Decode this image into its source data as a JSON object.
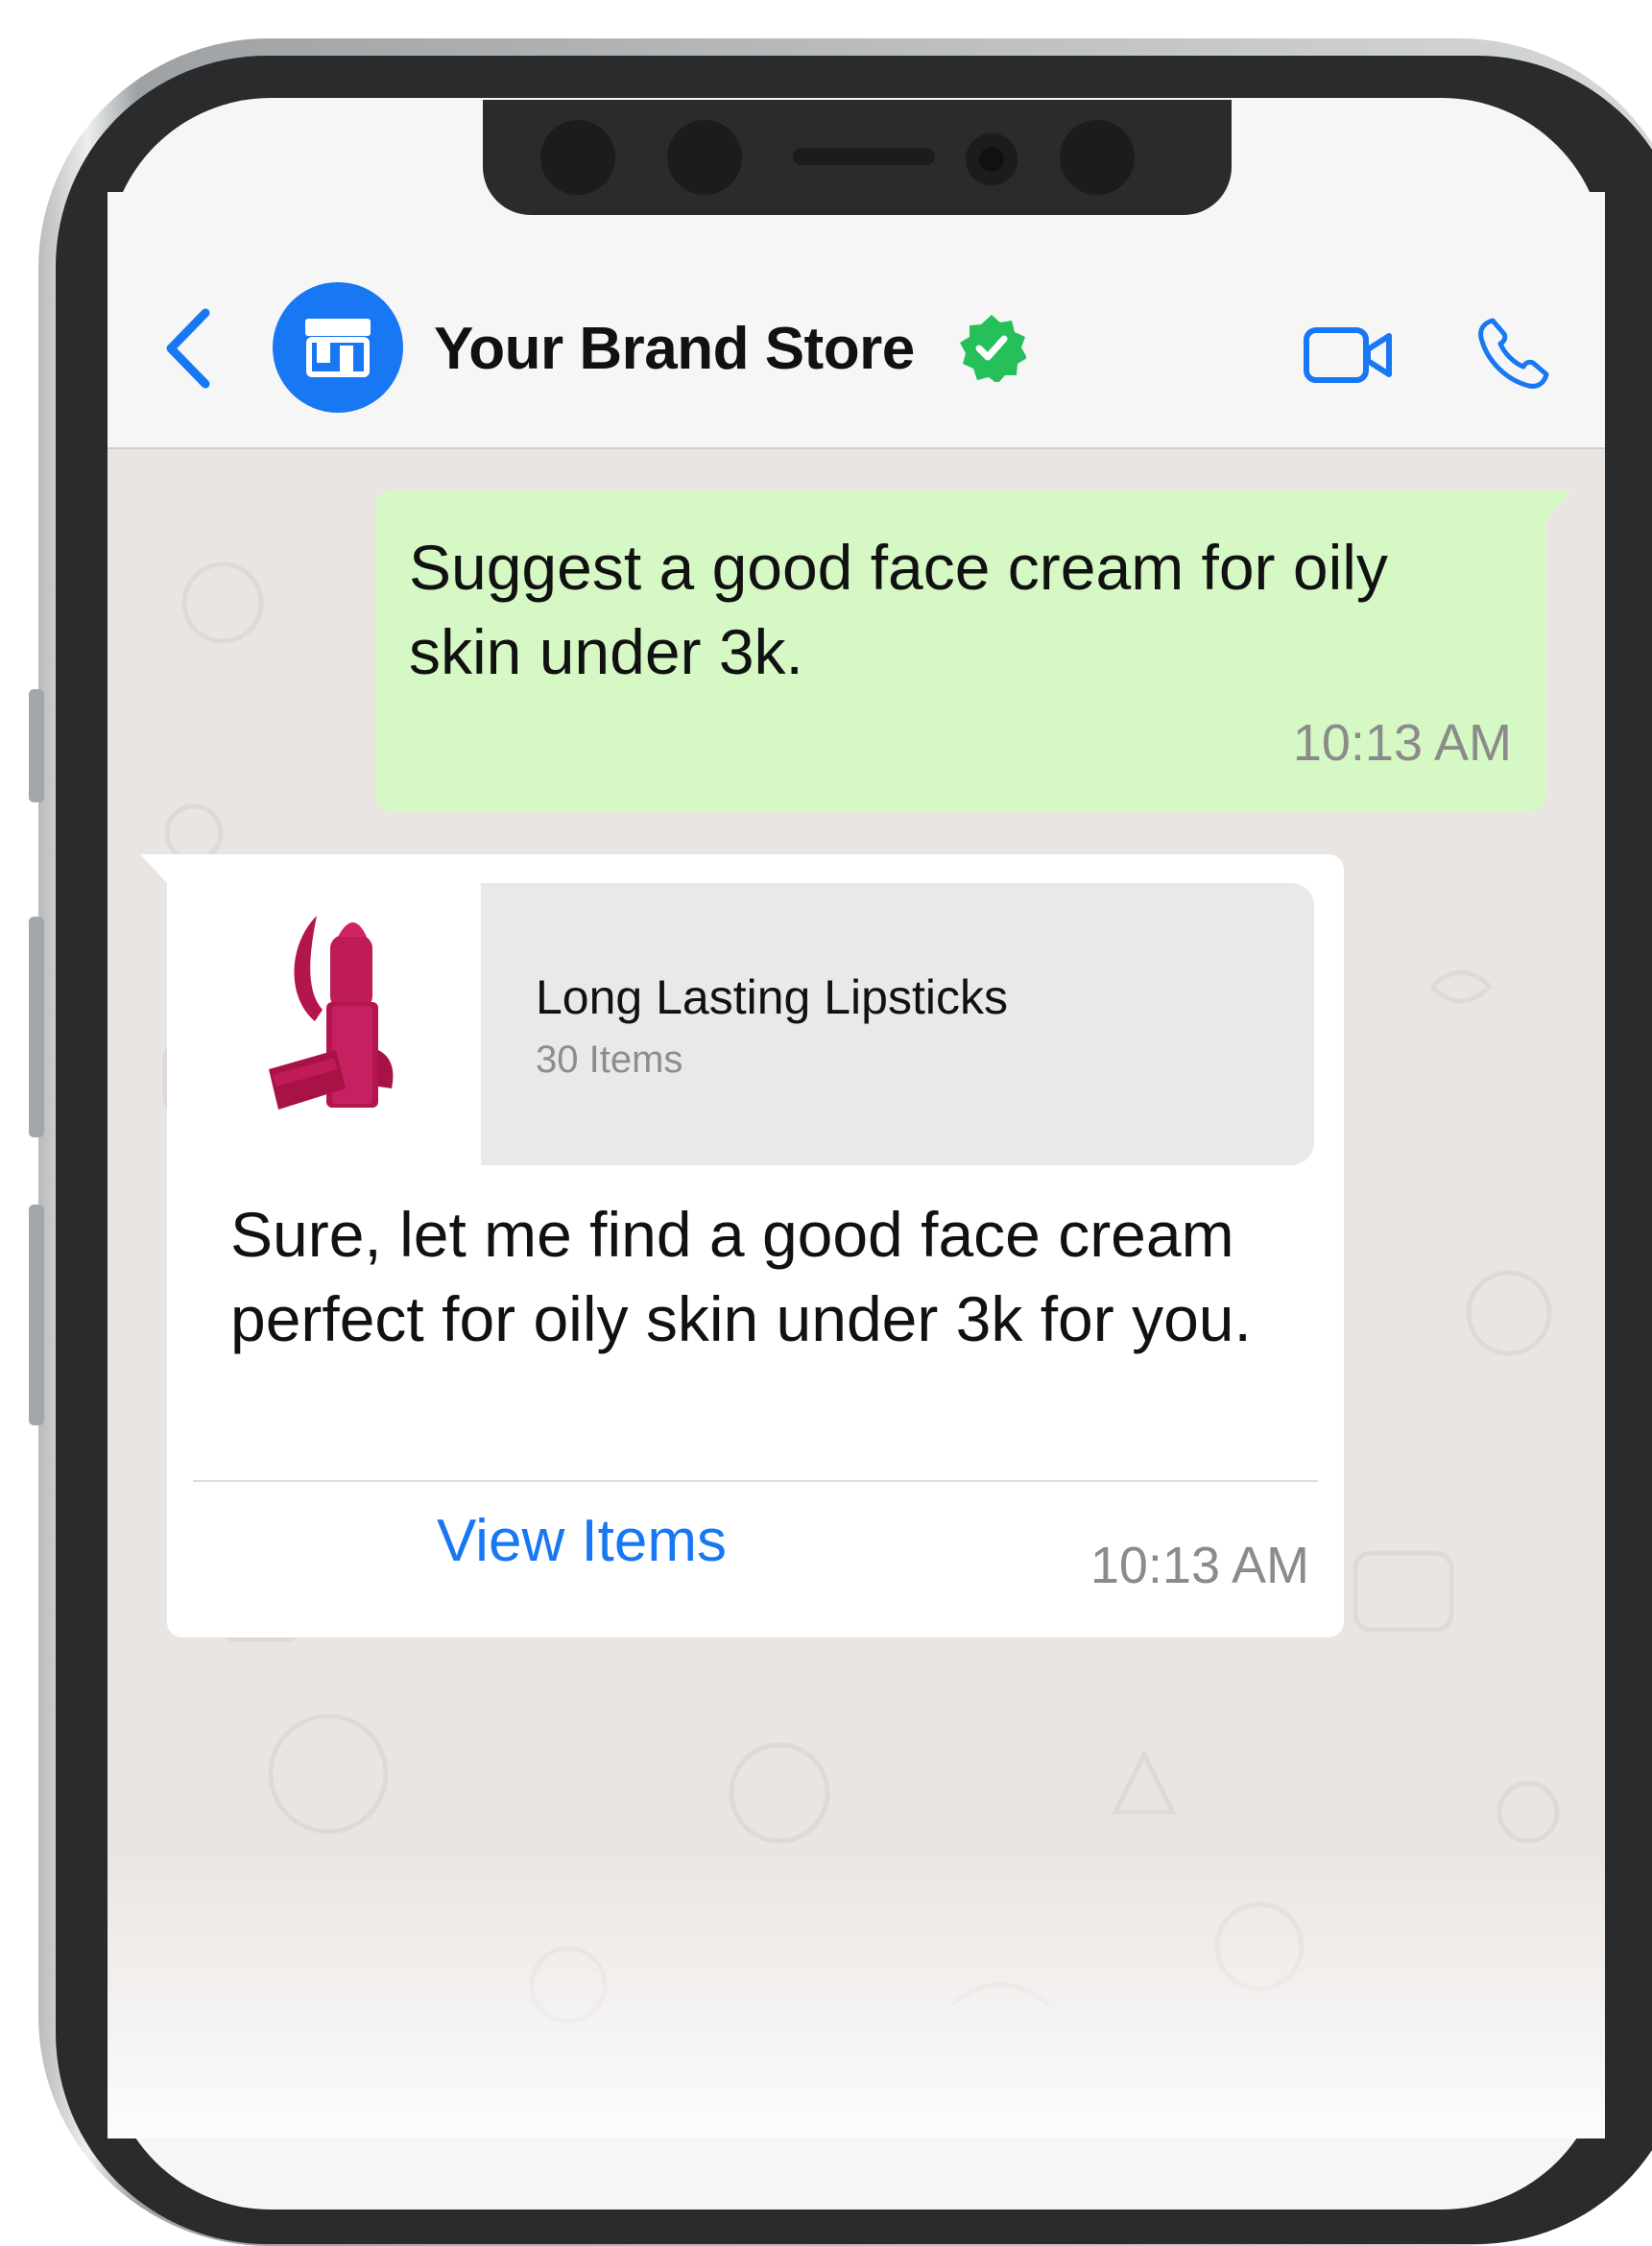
{
  "header": {
    "title": "Your Brand Store",
    "back_icon": "chevron-left-icon",
    "avatar_icon": "storefront-icon",
    "verified_icon": "verified-badge-icon",
    "video_icon": "video-camera-icon",
    "call_icon": "phone-icon"
  },
  "messages": {
    "outgoing": {
      "text": "Suggest a good face cream for oily skin under 3k.",
      "time": "10:13 AM"
    },
    "incoming": {
      "catalog_name": "Long Lasting Lipsticks",
      "catalog_count": "30 Items",
      "text": "Sure, let me find a good face cream perfect for oily skin under 3k for you.",
      "button_label": "View Items",
      "time": "10:13 AM"
    }
  },
  "colors": {
    "accent": "#1877f2",
    "verified": "#25c05a",
    "outgoing_bubble": "#d5f8c4",
    "incoming_bubble": "#ffffff",
    "chat_bg": "#e9e5e2",
    "lipstick": "#b3164f"
  }
}
